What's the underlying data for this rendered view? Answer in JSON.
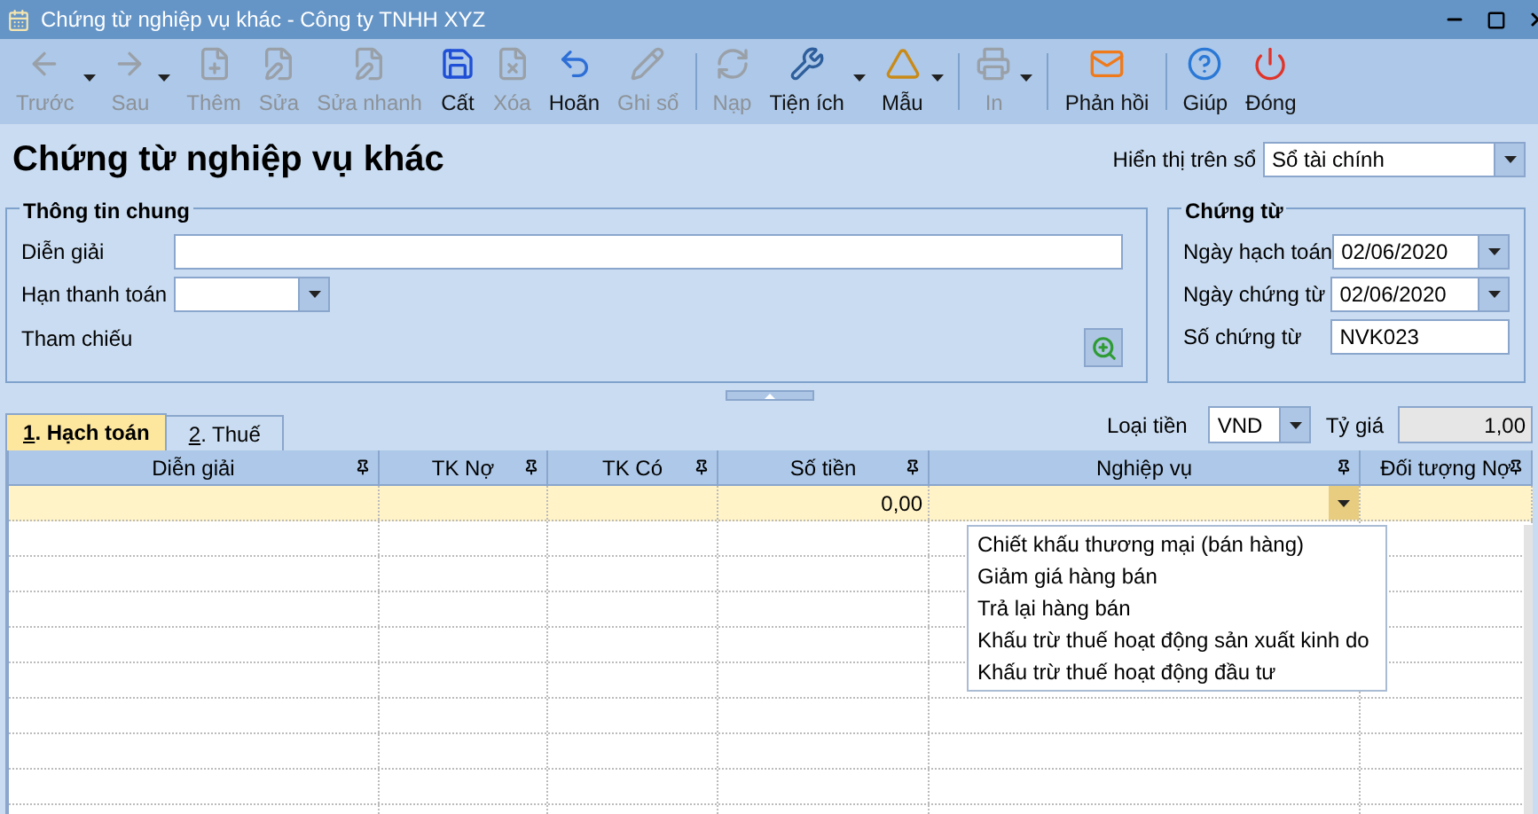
{
  "window": {
    "title": "Chứng từ nghiệp vụ khác - Công ty TNHH XYZ"
  },
  "toolbar": [
    {
      "kind": "prev",
      "label": "Trước",
      "disabled": true,
      "dropdown": true
    },
    {
      "kind": "next",
      "label": "Sau",
      "disabled": true,
      "dropdown": true
    },
    {
      "kind": "add",
      "label": "Thêm",
      "disabled": true,
      "dropdown": false
    },
    {
      "kind": "edit",
      "label": "Sửa",
      "disabled": true,
      "dropdown": false
    },
    {
      "kind": "quick-edit",
      "label": "Sửa nhanh",
      "disabled": true,
      "dropdown": false
    },
    {
      "kind": "save",
      "label": "Cất",
      "disabled": false,
      "dropdown": false
    },
    {
      "kind": "delete",
      "label": "Xóa",
      "disabled": true,
      "dropdown": false
    },
    {
      "kind": "undo",
      "label": "Hoãn",
      "disabled": false,
      "dropdown": false
    },
    {
      "kind": "post",
      "label": "Ghi sổ",
      "disabled": true,
      "dropdown": false
    },
    {
      "kind": "reload",
      "label": "Nạp",
      "disabled": true,
      "dropdown": false
    },
    {
      "kind": "utilities",
      "label": "Tiện ích",
      "disabled": false,
      "dropdown": true
    },
    {
      "kind": "template",
      "label": "Mẫu",
      "disabled": false,
      "dropdown": true
    },
    {
      "kind": "print",
      "label": "In",
      "disabled": true,
      "dropdown": true
    },
    {
      "kind": "feedback",
      "label": "Phản hồi",
      "disabled": false,
      "dropdown": false
    },
    {
      "kind": "help",
      "label": "Giúp",
      "disabled": false,
      "dropdown": false
    },
    {
      "kind": "close",
      "label": "Đóng",
      "disabled": false,
      "dropdown": false
    }
  ],
  "heading": "Chứng từ nghiệp vụ khác",
  "display_on": {
    "label": "Hiển thị trên sổ",
    "value": "Sổ tài chính"
  },
  "general": {
    "title": "Thông tin chung",
    "description": {
      "label": "Diễn giải"
    },
    "due_date": {
      "label": "Hạn thanh toán"
    },
    "reference": {
      "label": "Tham chiếu"
    }
  },
  "voucher": {
    "title": "Chứng từ",
    "posting_date": {
      "label": "Ngày hạch toán",
      "value": "02/06/2020"
    },
    "voucher_date": {
      "label": "Ngày chứng từ",
      "value": "02/06/2020"
    },
    "voucher_no": {
      "label": "Số chứng từ",
      "value": "NVK023"
    }
  },
  "tabs": [
    {
      "label": "1. Hạch toán",
      "selected": true
    },
    {
      "label": "2. Thuế",
      "selected": false
    }
  ],
  "currency": {
    "label": "Loại tiền",
    "value": "VND"
  },
  "exchange_rate": {
    "label": "Tỷ giá",
    "value": "1,00"
  },
  "grid": {
    "columns": [
      "Diễn giải",
      "TK Nợ",
      "TK Có",
      "Số tiền",
      "Nghiệp vụ",
      "Đối tượng Nợ"
    ],
    "rows": [
      {
        "amount": "0,00",
        "selected": true
      }
    ]
  },
  "dropdown": {
    "items": [
      "Chiết khấu thương mại (bán hàng)",
      "Giảm giá hàng bán",
      "Trả lại hàng bán",
      "Khấu trừ thuế hoạt động sản xuất kinh do",
      "Khấu trừ thuế hoạt động đầu tư"
    ]
  }
}
